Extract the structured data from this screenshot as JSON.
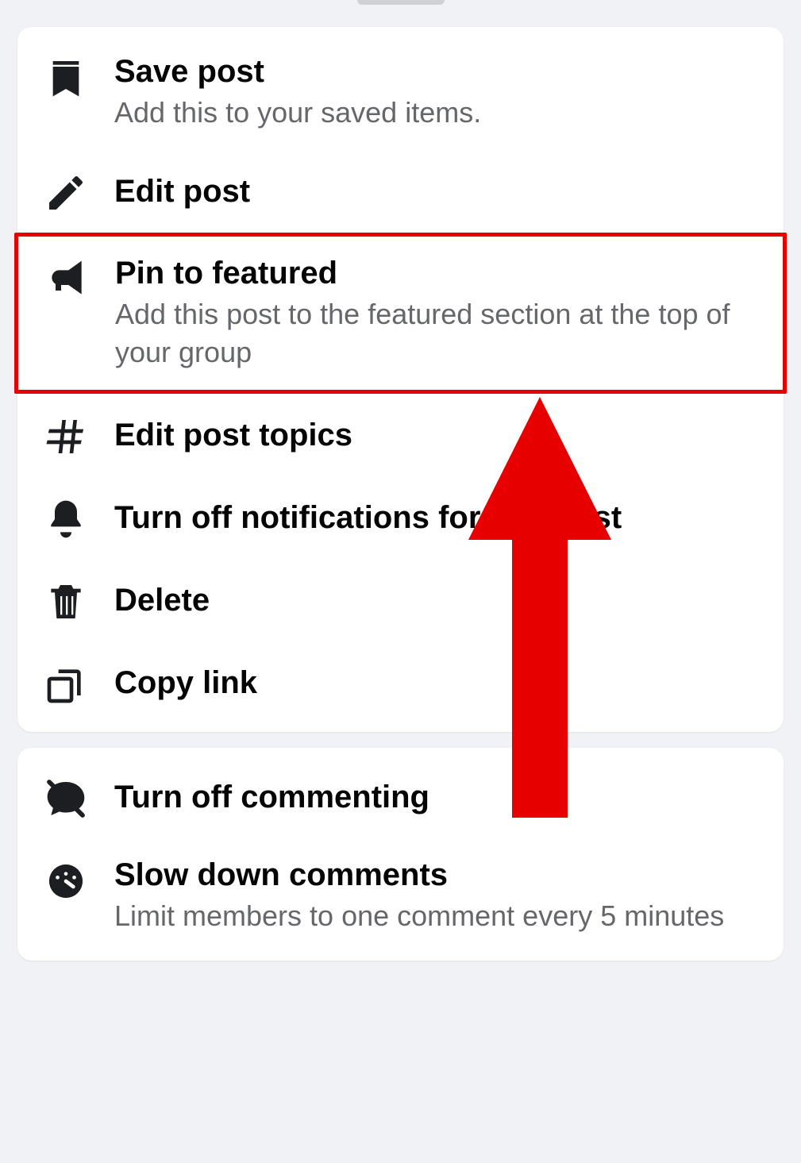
{
  "menu": {
    "group1": [
      {
        "key": "save",
        "title": "Save post",
        "subtitle": "Add this to your saved items.",
        "icon": "bookmark-icon"
      },
      {
        "key": "edit",
        "title": "Edit post",
        "subtitle": null,
        "icon": "pencil-icon"
      },
      {
        "key": "pin",
        "title": "Pin to featured",
        "subtitle": "Add this post to the featured section at the top of your group",
        "icon": "megaphone-icon",
        "highlighted": true
      },
      {
        "key": "topics",
        "title": "Edit post topics",
        "subtitle": null,
        "icon": "hash-icon"
      },
      {
        "key": "notifications",
        "title": "Turn off notifications for this post",
        "subtitle": null,
        "icon": "bell-icon"
      },
      {
        "key": "delete",
        "title": "Delete",
        "subtitle": null,
        "icon": "trash-icon"
      },
      {
        "key": "copylink",
        "title": "Copy link",
        "subtitle": null,
        "icon": "copy-icon"
      }
    ],
    "group2": [
      {
        "key": "commenting",
        "title": "Turn off commenting",
        "subtitle": null,
        "icon": "comment-off-icon"
      },
      {
        "key": "slowdown",
        "title": "Slow down comments",
        "subtitle": "Limit members to one comment every 5 minutes",
        "icon": "gauge-icon"
      }
    ]
  },
  "annotation": {
    "type": "arrow-pointing-up",
    "color": "#e60000",
    "target": "pin-to-featured"
  }
}
